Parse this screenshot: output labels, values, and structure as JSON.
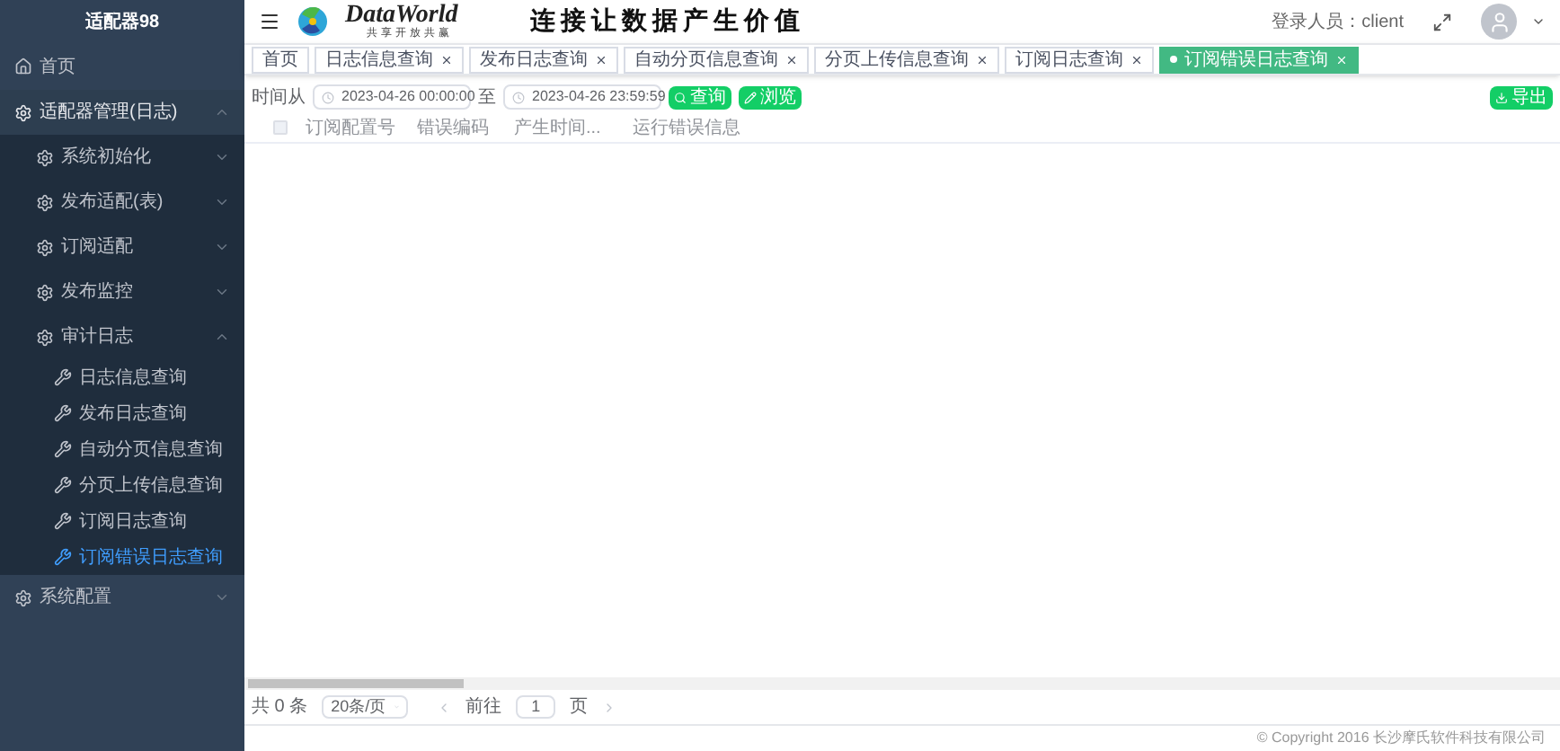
{
  "sidebar": {
    "title": "适配器98",
    "items": [
      {
        "kind": "home",
        "label": "首页"
      },
      {
        "kind": "group",
        "label": "适配器管理(日志)",
        "expanded": true,
        "children": [
          {
            "kind": "group",
            "label": "系统初始化",
            "expanded": false
          },
          {
            "kind": "group",
            "label": "发布适配(表)",
            "expanded": false
          },
          {
            "kind": "group",
            "label": "订阅适配",
            "expanded": false
          },
          {
            "kind": "group",
            "label": "发布监控",
            "expanded": false
          },
          {
            "kind": "group",
            "label": "审计日志",
            "expanded": true,
            "children": [
              {
                "kind": "leaf",
                "label": "日志信息查询",
                "selected": false
              },
              {
                "kind": "leaf",
                "label": "发布日志查询",
                "selected": false
              },
              {
                "kind": "leaf",
                "label": "自动分页信息查询",
                "selected": false
              },
              {
                "kind": "leaf",
                "label": "分页上传信息查询",
                "selected": false
              },
              {
                "kind": "leaf",
                "label": "订阅日志查询",
                "selected": false
              },
              {
                "kind": "leaf",
                "label": "订阅错误日志查询",
                "selected": true
              }
            ]
          }
        ]
      },
      {
        "kind": "group",
        "label": "系统配置",
        "expanded": false
      }
    ]
  },
  "header": {
    "logo_text": "DataWorld",
    "logo_subtitle": "共享开放共赢",
    "slogan": "连接让数据产生价值",
    "user_label": "登录人员：client"
  },
  "tabs": [
    {
      "label": "首页",
      "selected": false,
      "closable": false
    },
    {
      "label": "日志信息查询",
      "selected": false,
      "closable": true
    },
    {
      "label": "发布日志查询",
      "selected": false,
      "closable": true
    },
    {
      "label": "自动分页信息查询",
      "selected": false,
      "closable": true
    },
    {
      "label": "分页上传信息查询",
      "selected": false,
      "closable": true
    },
    {
      "label": "订阅日志查询",
      "selected": false,
      "closable": true
    },
    {
      "label": "订阅错误日志查询",
      "selected": true,
      "closable": true
    }
  ],
  "filter": {
    "from_label": "时间从",
    "from_value": "2023-04-26 00:00:00",
    "to_label": "至",
    "to_value": "2023-04-26 23:59:59",
    "buttons": [
      "查询",
      "浏览"
    ],
    "export_button": "导出"
  },
  "table": {
    "columns": [
      "订阅配置号",
      "错误编码",
      "产生时间...",
      "运行错误信息"
    ],
    "select_all_checked": false
  },
  "pagination": {
    "total": "共 0 条",
    "page_size": "20条/页",
    "goto_label": "前往",
    "page": "1",
    "page_suffix": "页"
  },
  "footer": {
    "copyright": "© Copyright 2016 长沙摩氏软件科技有限公司"
  }
}
